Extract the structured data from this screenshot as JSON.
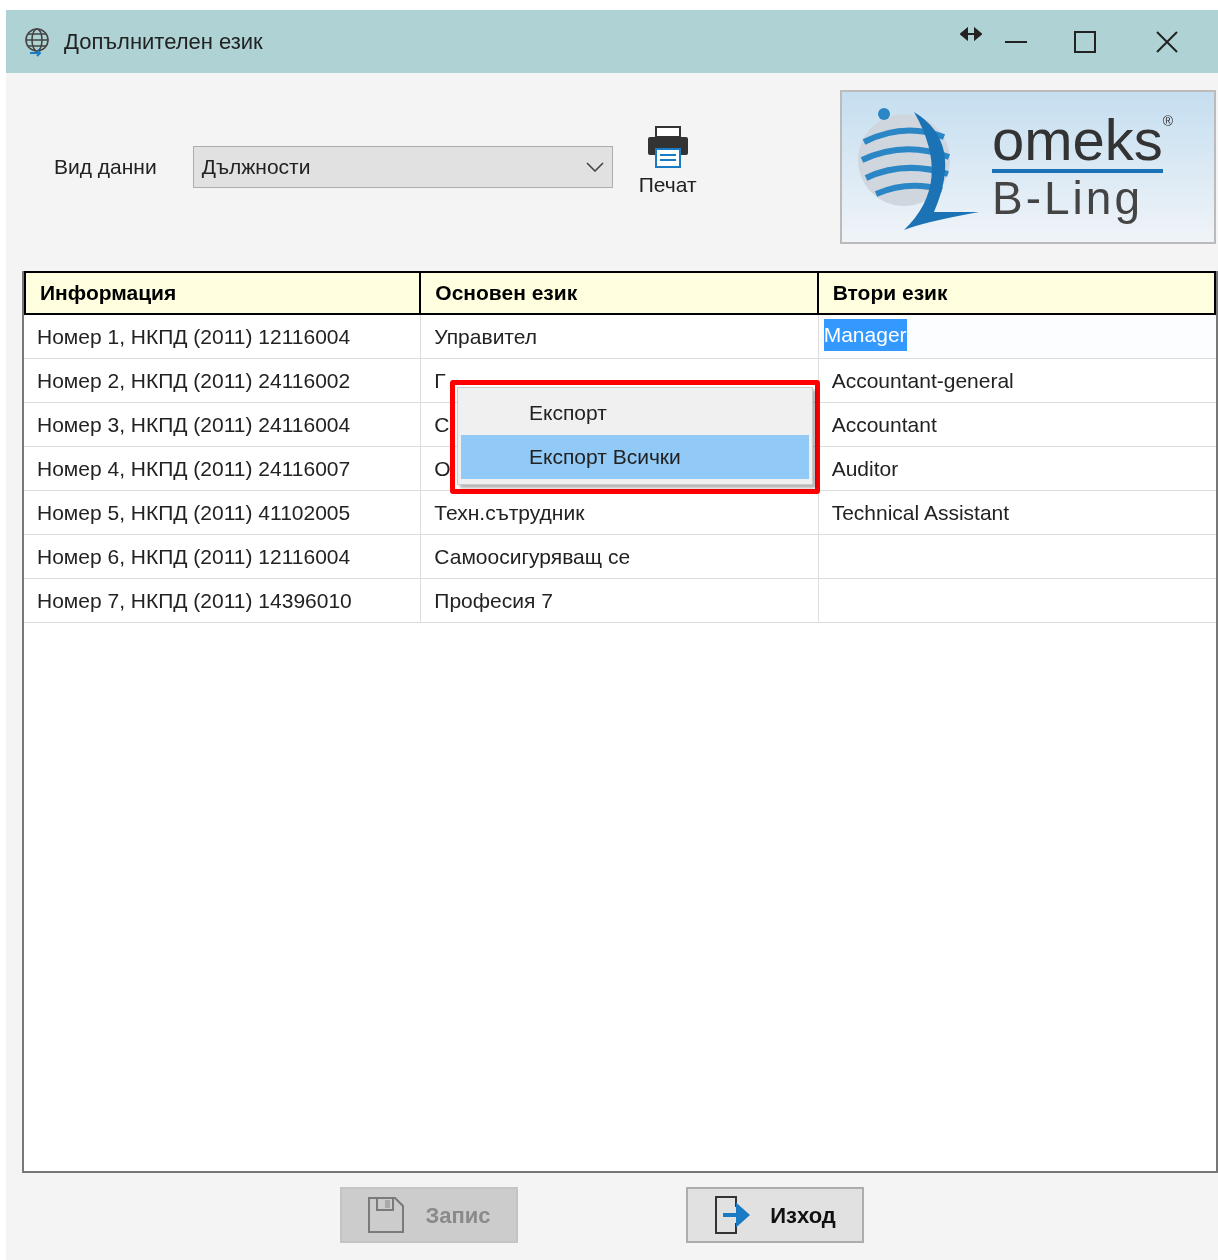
{
  "window": {
    "title": "Допълнителен език"
  },
  "toolbar": {
    "data_label": "Вид данни",
    "data_value": "Дължности",
    "print_label": "Печат"
  },
  "logo": {
    "brand": "omeks",
    "mark": "®",
    "product": "B-Ling"
  },
  "table": {
    "columns": [
      "Информация",
      "Основен език",
      "Втори език"
    ],
    "rows": [
      {
        "info": "Номер 1, НКПД (2011) 12116004",
        "main": "Управител",
        "second": "Manager",
        "second_selected": true
      },
      {
        "info": "Номер 2, НКПД (2011) 24116002",
        "main": "Г",
        "second": "Accountant-general",
        "second_selected": false
      },
      {
        "info": "Номер 3, НКПД (2011) 24116004",
        "main": "С",
        "second": "Accountant",
        "second_selected": false
      },
      {
        "info": "Номер 4, НКПД (2011) 24116007",
        "main": "О",
        "second": "Auditor",
        "second_selected": false
      },
      {
        "info": "Номер 5, НКПД (2011) 41102005",
        "main": "Техн.сътрудник",
        "second": "Technical Assistant",
        "second_selected": false
      },
      {
        "info": "Номер 6, НКПД (2011) 12116004",
        "main": "Самоосигуряващ се",
        "second_selected": false
      },
      {
        "info": "Номер 7, НКПД (2011) 14396010",
        "main": "Професия 7",
        "second_selected": false
      }
    ]
  },
  "context_menu": {
    "items": [
      {
        "label": "Експорт",
        "selected": false
      },
      {
        "label": "Експорт Всички",
        "selected": true
      }
    ]
  },
  "buttons": [
    {
      "kind": "save",
      "label": "Запис",
      "disabled": true
    },
    {
      "kind": "exit",
      "label": "Изход",
      "disabled": false
    }
  ]
}
